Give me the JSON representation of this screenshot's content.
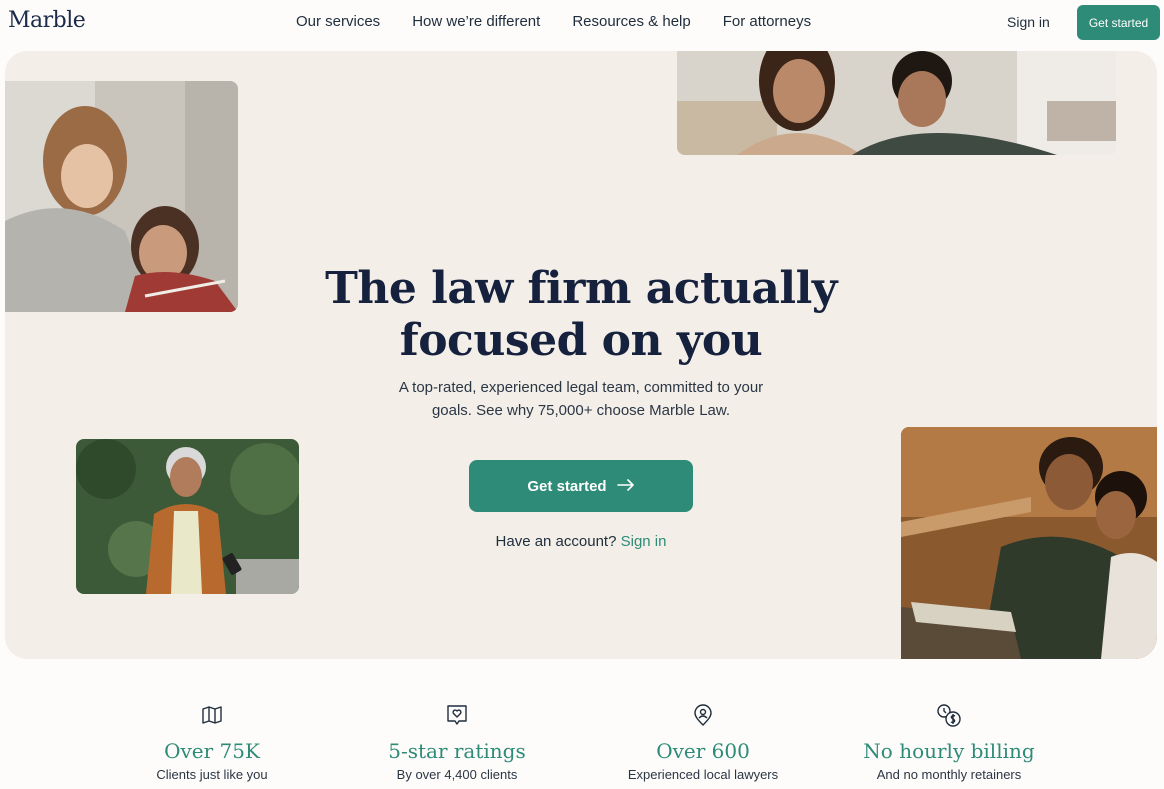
{
  "brand": {
    "logo": "Marble"
  },
  "nav": {
    "items": [
      "Our services",
      "How we’re different",
      "Resources & help",
      "For attorneys"
    ],
    "sign_in": "Sign in",
    "cta": "Get started"
  },
  "hero": {
    "headline_line1": "The law firm actually",
    "headline_line2": "focused on you",
    "subtext_line1": "A top-rated, experienced legal team, committed to your",
    "subtext_line2": "goals. See why 75,000+ choose Marble Law.",
    "cta": "Get started",
    "account_prompt": "Have an account?",
    "account_link": "Sign in"
  },
  "stats": [
    {
      "icon": "map-icon",
      "value": "Over 75K",
      "caption": "Clients just like you"
    },
    {
      "icon": "heart-badge-icon",
      "value": "5-star ratings",
      "caption": "By over 4,400 clients"
    },
    {
      "icon": "location-person-icon",
      "value": "Over 600",
      "caption": "Experienced local lawyers"
    },
    {
      "icon": "no-billing-icon",
      "value": "No hourly billing",
      "caption": "And no monthly retainers"
    }
  ],
  "colors": {
    "accent": "#2e8b77",
    "hero_bg": "#f3efe8",
    "heading": "#16213e"
  }
}
